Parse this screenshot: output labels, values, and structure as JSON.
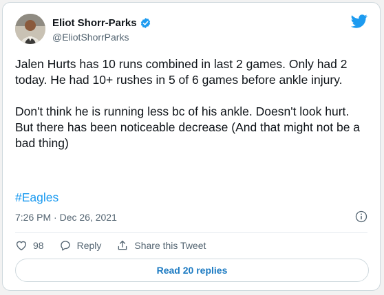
{
  "author": {
    "name": "Eliot Shorr-Parks",
    "handle": "@EliotShorrParks"
  },
  "tweet": {
    "paragraph1": "Jalen Hurts has 10 runs combined in last 2 games. Only had 2 today. He had 10+ rushes in 5 of 6 games before ankle injury.",
    "paragraph2": "Don't think he is running less bc of his ankle. Doesn't look hurt. But there has been noticeable decrease (And that might not be a bad thing)",
    "hashtag": "#Eagles",
    "time": "7:26 PM",
    "separator": "·",
    "date": "Dec 26, 2021"
  },
  "actions": {
    "like_count": "98",
    "reply_label": "Reply",
    "share_label": "Share this Tweet"
  },
  "replies_button": "Read 20 replies",
  "icons": {
    "verified": "verified-badge-icon",
    "brand": "twitter-bird-icon",
    "info": "info-icon",
    "like": "heart-icon",
    "reply": "speech-bubble-icon",
    "share": "share-upload-icon"
  },
  "colors": {
    "accent": "#1d9bf0",
    "text": "#0f1419",
    "muted": "#536471",
    "link_button": "#1b7ac2"
  }
}
